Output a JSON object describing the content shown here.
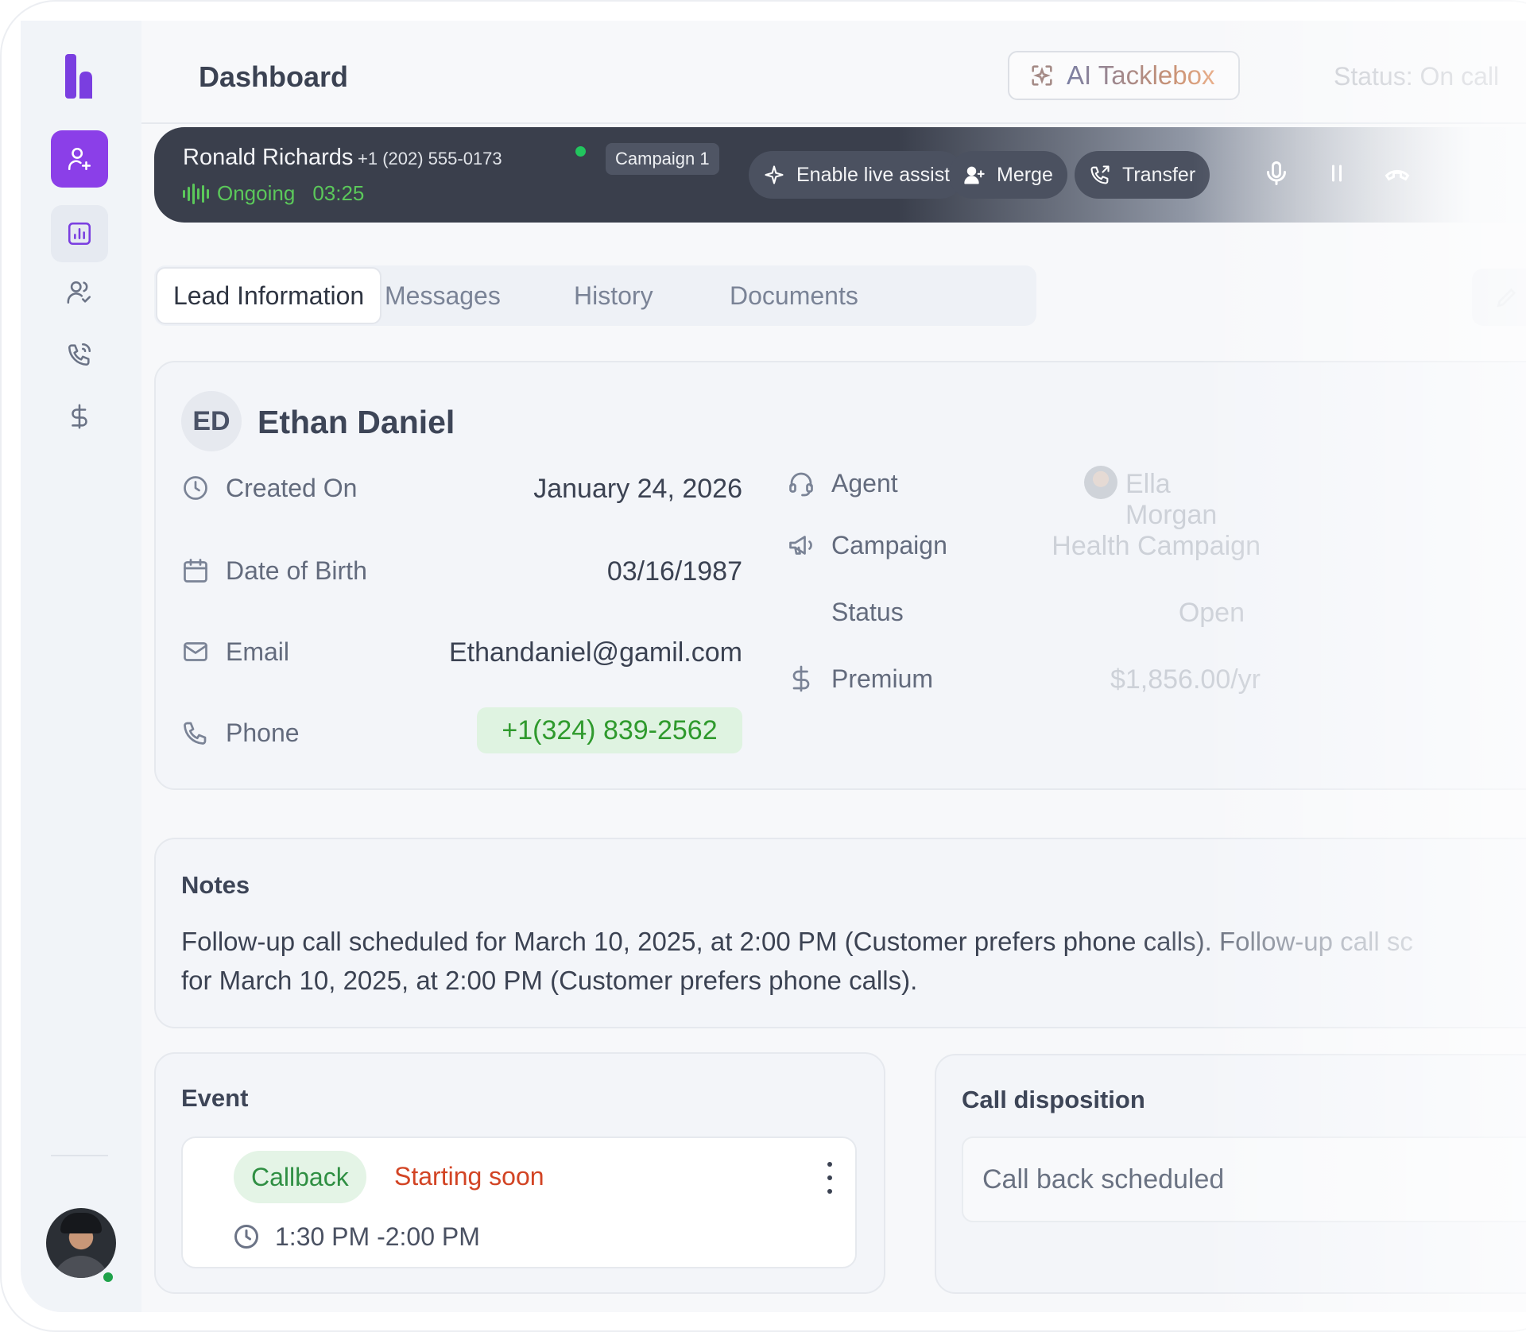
{
  "header": {
    "page_title": "Dashboard",
    "ai_button_label": "AI Tacklebox",
    "status": "Status: On call"
  },
  "sidebar": {
    "items": [
      {
        "name": "add-lead",
        "icon": "user-plus-icon",
        "active": true
      },
      {
        "name": "reports",
        "icon": "bar-chart-icon",
        "active": false
      },
      {
        "name": "contacts",
        "icon": "users-check-icon",
        "active": false
      },
      {
        "name": "calls",
        "icon": "phone-ring-icon",
        "active": false
      },
      {
        "name": "billing",
        "icon": "dollar-icon",
        "active": false
      }
    ],
    "user_online": true
  },
  "call_bar": {
    "caller_name": "Ronald Richards",
    "caller_phone": "+1 (202) 555-0173",
    "campaign": "Campaign 1",
    "state": "Ongoing",
    "timer": "03:25",
    "buttons": {
      "live_assist": "Enable live assist",
      "merge": "Merge",
      "transfer": "Transfer"
    }
  },
  "tabs": [
    {
      "label": "Lead Information",
      "active": true
    },
    {
      "label": "Messages",
      "active": false
    },
    {
      "label": "History",
      "active": false
    },
    {
      "label": "Documents",
      "active": false
    }
  ],
  "lead": {
    "initials": "ED",
    "name": "Ethan Daniel",
    "fields_left": [
      {
        "label": "Created On",
        "value": "January 24, 2026",
        "icon": "clock-icon"
      },
      {
        "label": "Date of Birth",
        "value": "03/16/1987",
        "icon": "calendar-icon"
      },
      {
        "label": "Email",
        "value": "Ethandaniel@gamil.com",
        "icon": "mail-icon"
      },
      {
        "label": "Phone",
        "value": "+1(324) 839-2562",
        "icon": "phone-icon"
      }
    ],
    "fields_right": [
      {
        "label": "Agent",
        "value": "Ella Morgan",
        "icon": "headset-icon"
      },
      {
        "label": "Campaign",
        "value": "Health Campaign",
        "icon": "megaphone-icon"
      },
      {
        "label": "Status",
        "value": "Open",
        "icon": ""
      },
      {
        "label": "Premium",
        "value": "$1,856.00/yr",
        "icon": "dollar-icon"
      }
    ]
  },
  "notes": {
    "title": "Notes",
    "line1": "Follow-up call scheduled for March 10, 2025, at 2:00 PM (Customer prefers phone calls). Follow-up call sc",
    "line2": "for March 10, 2025, at 2:00 PM (Customer prefers phone calls)."
  },
  "event": {
    "title": "Event",
    "type": "Callback",
    "status": "Starting soon",
    "time": "1:30 PM -2:00 PM"
  },
  "disposition": {
    "title": "Call disposition",
    "value": "Call back scheduled"
  },
  "colors": {
    "accent": "#8b3fe8",
    "call_bar": "#3a3f4c",
    "ongoing_green": "#5bc85a",
    "phone_chip_bg": "#dff3e1",
    "phone_chip_text": "#2f9a2d",
    "starting_soon": "#d24424"
  }
}
